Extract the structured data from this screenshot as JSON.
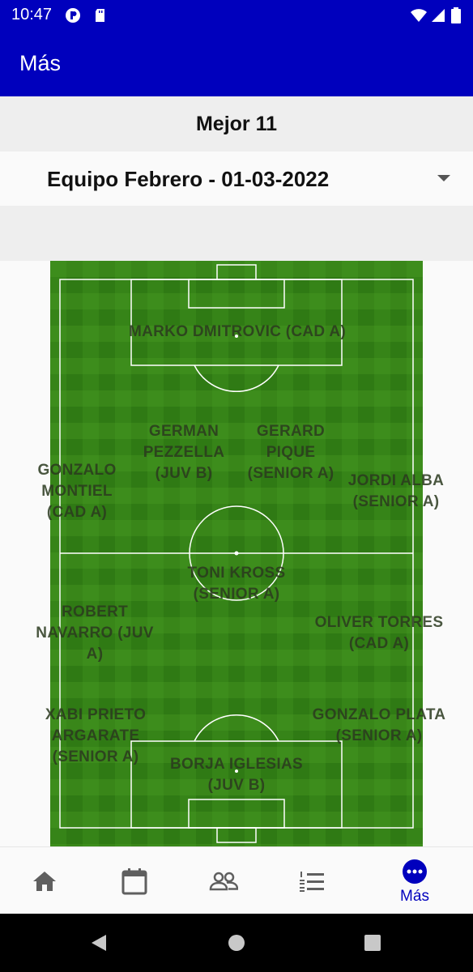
{
  "status": {
    "time": "10:47"
  },
  "appbar": {
    "title": "Más"
  },
  "section": {
    "title": "Mejor 11"
  },
  "selector": {
    "value": "Equipo Febrero - 01-03-2022"
  },
  "players": [
    {
      "name": "MARKO DMITROVIC (CAD A)"
    },
    {
      "name": "GERMAN PEZZELLA (JUV B)"
    },
    {
      "name": "GERARD PIQUE (SENIOR A)"
    },
    {
      "name": "GONZALO MONTIEL (CAD A)"
    },
    {
      "name": "JORDI ALBA (SENIOR A)"
    },
    {
      "name": "TONI KROSS (SENIOR A)"
    },
    {
      "name": "ROBERT NAVARRO (JUV A)"
    },
    {
      "name": "OLIVER TORRES (CAD A)"
    },
    {
      "name": "XABI PRIETO ARGARATE (SENIOR A)"
    },
    {
      "name": "GONZALO PLATA (SENIOR A)"
    },
    {
      "name": "BORJA IGLESIAS (JUV B)"
    }
  ],
  "nav": {
    "items": [
      {
        "icon": "home-icon"
      },
      {
        "icon": "calendar-icon"
      },
      {
        "icon": "people-icon"
      },
      {
        "icon": "list-icon"
      },
      {
        "icon": "more-icon",
        "label": "Más",
        "active": true
      }
    ]
  },
  "colors": {
    "primary": "#0000bd",
    "pitch_dark": "#2f7a14",
    "pitch_light": "#4a9c22"
  }
}
